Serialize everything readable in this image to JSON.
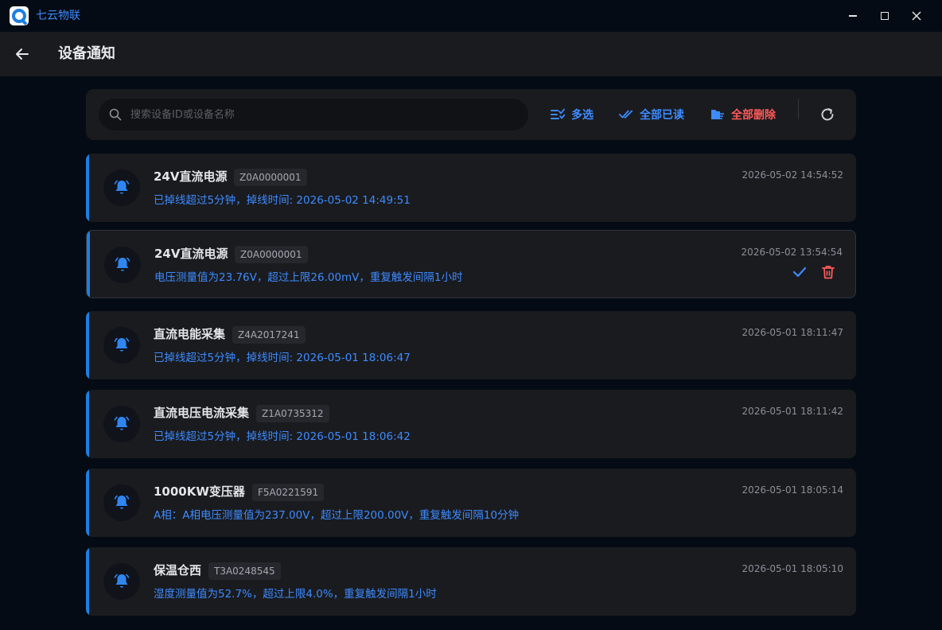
{
  "app": {
    "title": "七云物联",
    "logo_icon": "q-logo-icon"
  },
  "window": {
    "minimize_icon": "minimize-icon",
    "maximize_icon": "maximize-icon",
    "close_icon": "close-icon"
  },
  "header": {
    "title": "设备通知",
    "back_icon": "arrow-left-icon"
  },
  "toolbar": {
    "search_placeholder": "搜索设备ID或设备名称",
    "multi_select_label": "多选",
    "read_all_label": "全部已读",
    "delete_all_label": "全部删除"
  },
  "colors": {
    "accent": "#3d8bff",
    "danger": "#ff5a5a",
    "card_bg": "#1a1b1f",
    "page_bg": "#050b14"
  },
  "notifications": [
    {
      "device_name": "24V直流电源",
      "device_id": "Z0A0000001",
      "message": "已掉线超过5分钟，掉线时间: 2026-05-02 14:49:51",
      "time": "2026-05-02 14:54:52"
    },
    {
      "device_name": "24V直流电源",
      "device_id": "Z0A0000001",
      "message": "电压测量值为23.76V，超过上限26.00mV，重复触发间隔1小时",
      "time": "2026-05-02 13:54:54"
    },
    {
      "device_name": "直流电能采集",
      "device_id": "Z4A2017241",
      "message": "已掉线超过5分钟，掉线时间: 2026-05-01 18:06:47",
      "time": "2026-05-01 18:11:47"
    },
    {
      "device_name": "直流电压电流采集",
      "device_id": "Z1A0735312",
      "message": "已掉线超过5分钟，掉线时间: 2026-05-01 18:06:42",
      "time": "2026-05-01 18:11:42"
    },
    {
      "device_name": "1000KW变压器",
      "device_id": "F5A0221591",
      "message": "A相：A相电压测量值为237.00V，超过上限200.00V，重复触发间隔10分钟",
      "time": "2026-05-01 18:05:14"
    },
    {
      "device_name": "保温仓西",
      "device_id": "T3A0248545",
      "message": "湿度测量值为52.7%，超过上限4.0%，重复触发间隔1小时",
      "time": "2026-05-01 18:05:10"
    }
  ]
}
